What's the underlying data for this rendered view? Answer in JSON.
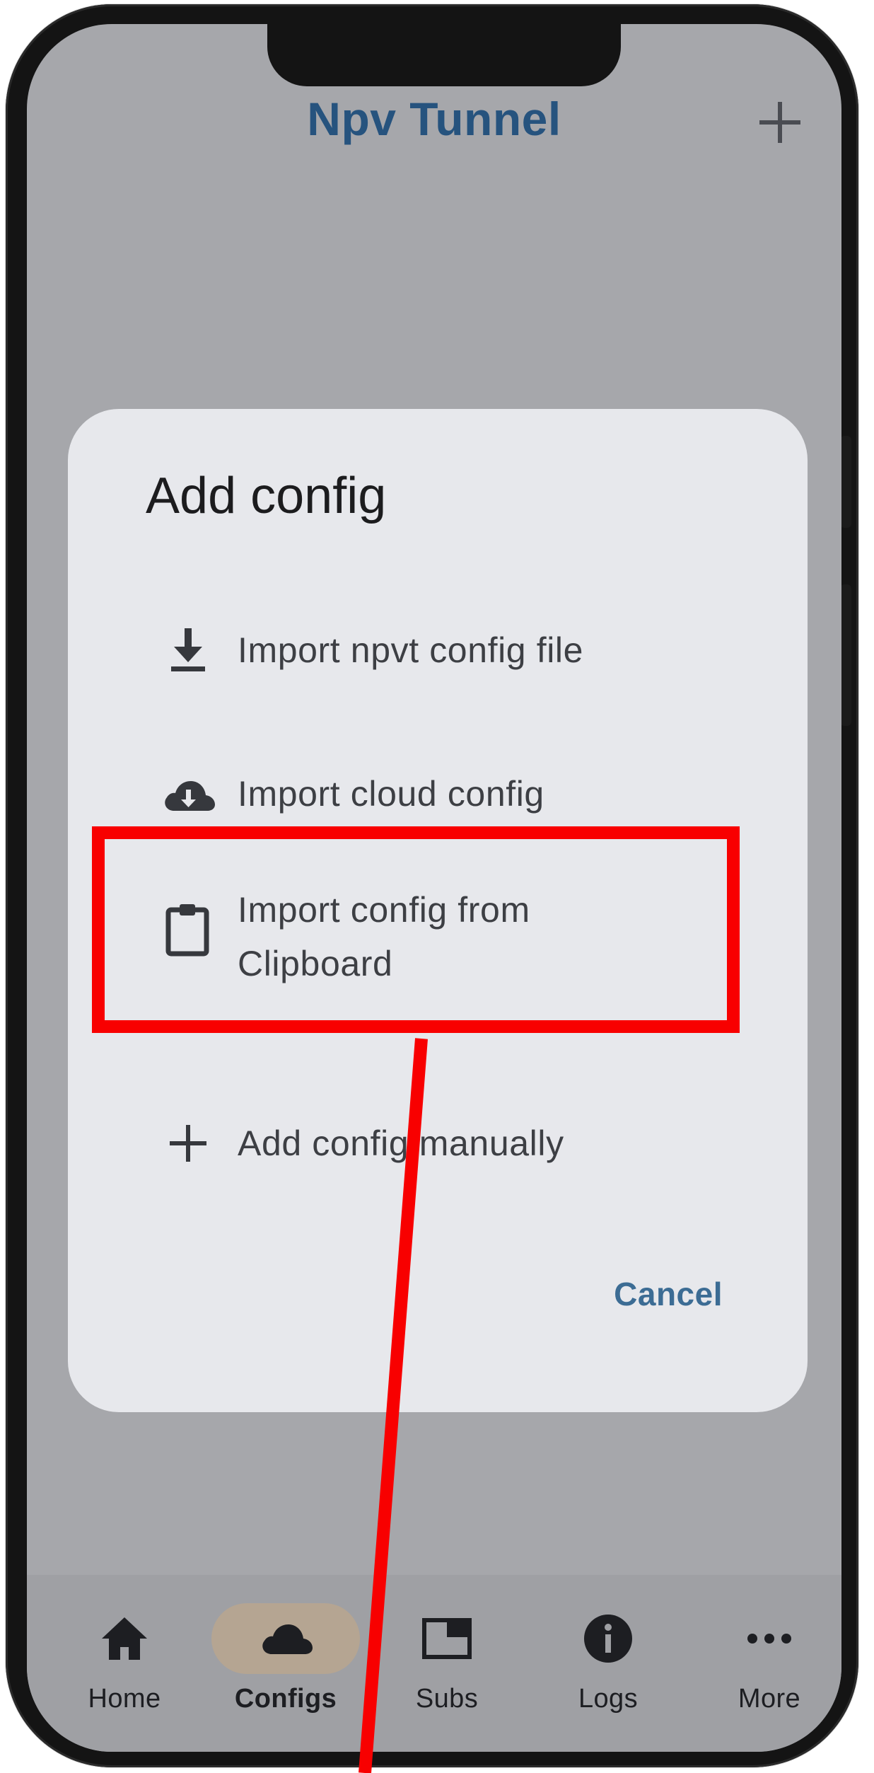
{
  "app": {
    "title": "Npv Tunnel",
    "add_icon": "plus-icon"
  },
  "dialog": {
    "title": "Add config",
    "items": [
      {
        "label": "Import npvt config file",
        "icon": "download-icon"
      },
      {
        "label": "Import cloud config",
        "icon": "cloud-download-icon"
      },
      {
        "label": "Import config from",
        "label_line2": "Clipboard",
        "icon": "clipboard-icon"
      },
      {
        "label": "Add config manually",
        "icon": "plus-icon"
      }
    ],
    "cancel_label": "Cancel"
  },
  "bottom_nav": {
    "items": [
      {
        "label": "Home",
        "icon": "home-icon",
        "active": false
      },
      {
        "label": "Configs",
        "icon": "cloud-icon",
        "active": true
      },
      {
        "label": "Subs",
        "icon": "subscriptions-icon",
        "active": false
      },
      {
        "label": "Logs",
        "icon": "info-icon",
        "active": false
      },
      {
        "label": "More",
        "icon": "more-horizontal-icon",
        "active": false
      }
    ]
  },
  "colors": {
    "title": "#26537e",
    "cancel": "#3c6c94",
    "annotation": "#f80000",
    "active_pill": "#b5a592",
    "dialog_bg": "#e7e8ec",
    "scrim_bg": "#a6a7ab"
  }
}
